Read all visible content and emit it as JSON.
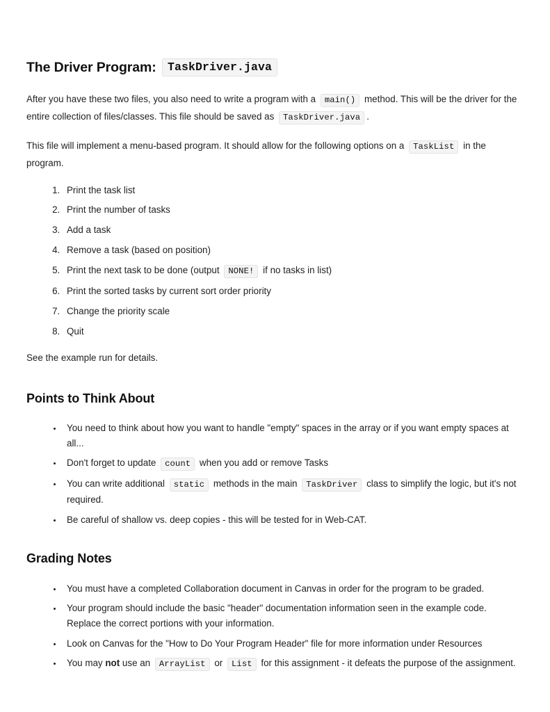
{
  "document": {
    "title_prefix": "The Driver Program:",
    "title_code": "TaskDriver.java",
    "intro_paragraph": {
      "part1": "After you have these two files, you also need to write a program with a",
      "code1": "main()",
      "part2": "method. This will be the driver for the entire collection of files/classes. This file should be saved as",
      "code2": "TaskDriver.java",
      "part3": "."
    },
    "menu_paragraph": {
      "part1": "This file will implement a menu-based program. It should allow for the following options on a",
      "code1": "TaskList",
      "part2": "in the program."
    },
    "menu_options": [
      "Print the task list",
      "Print the number of tasks",
      "Add a task",
      "Remove a task (based on position)",
      "Print the next task to be done (output ",
      "Print the sorted tasks by current sort order priority",
      "Change the priority scale",
      "Quit"
    ],
    "menu_option_5": {
      "part1": "Print the next task to be done (output",
      "code1": "NONE!",
      "part2": "if no tasks in list)"
    },
    "example_note": "See the example run for details.",
    "points_heading": "Points to Think About",
    "points": {
      "item1": "You need to think about how you want to handle \"empty\" spaces in the array or if you want empty spaces at all...",
      "item2": {
        "part1": "Don't forget to update",
        "code1": "count",
        "part2": "when you add or remove Tasks"
      },
      "item3": {
        "part1": "You can write additional",
        "code1": "static",
        "part2": "methods in the main",
        "code2": "TaskDriver",
        "part3": "class to simplify the logic, but it's not required."
      },
      "item4": "Be careful of shallow vs. deep copies - this will be tested for in Web-CAT."
    },
    "grading_heading": "Grading Notes",
    "grading": {
      "item1": "You must have a completed Collaboration document in Canvas in order for the program to be graded.",
      "item2": "Your program should include the basic \"header\" documentation information seen in the example code. Replace the correct portions with your information.",
      "item3": "Look on Canvas for the \"How to Do Your Program Header\" file for more information under Resources",
      "item4": {
        "part1": "You may",
        "emphasis": "not",
        "part2": "use an",
        "code1": "ArrayList",
        "part3": "or",
        "code2": "List",
        "part4": "for this assignment - it defeats the purpose of the assignment."
      }
    }
  }
}
